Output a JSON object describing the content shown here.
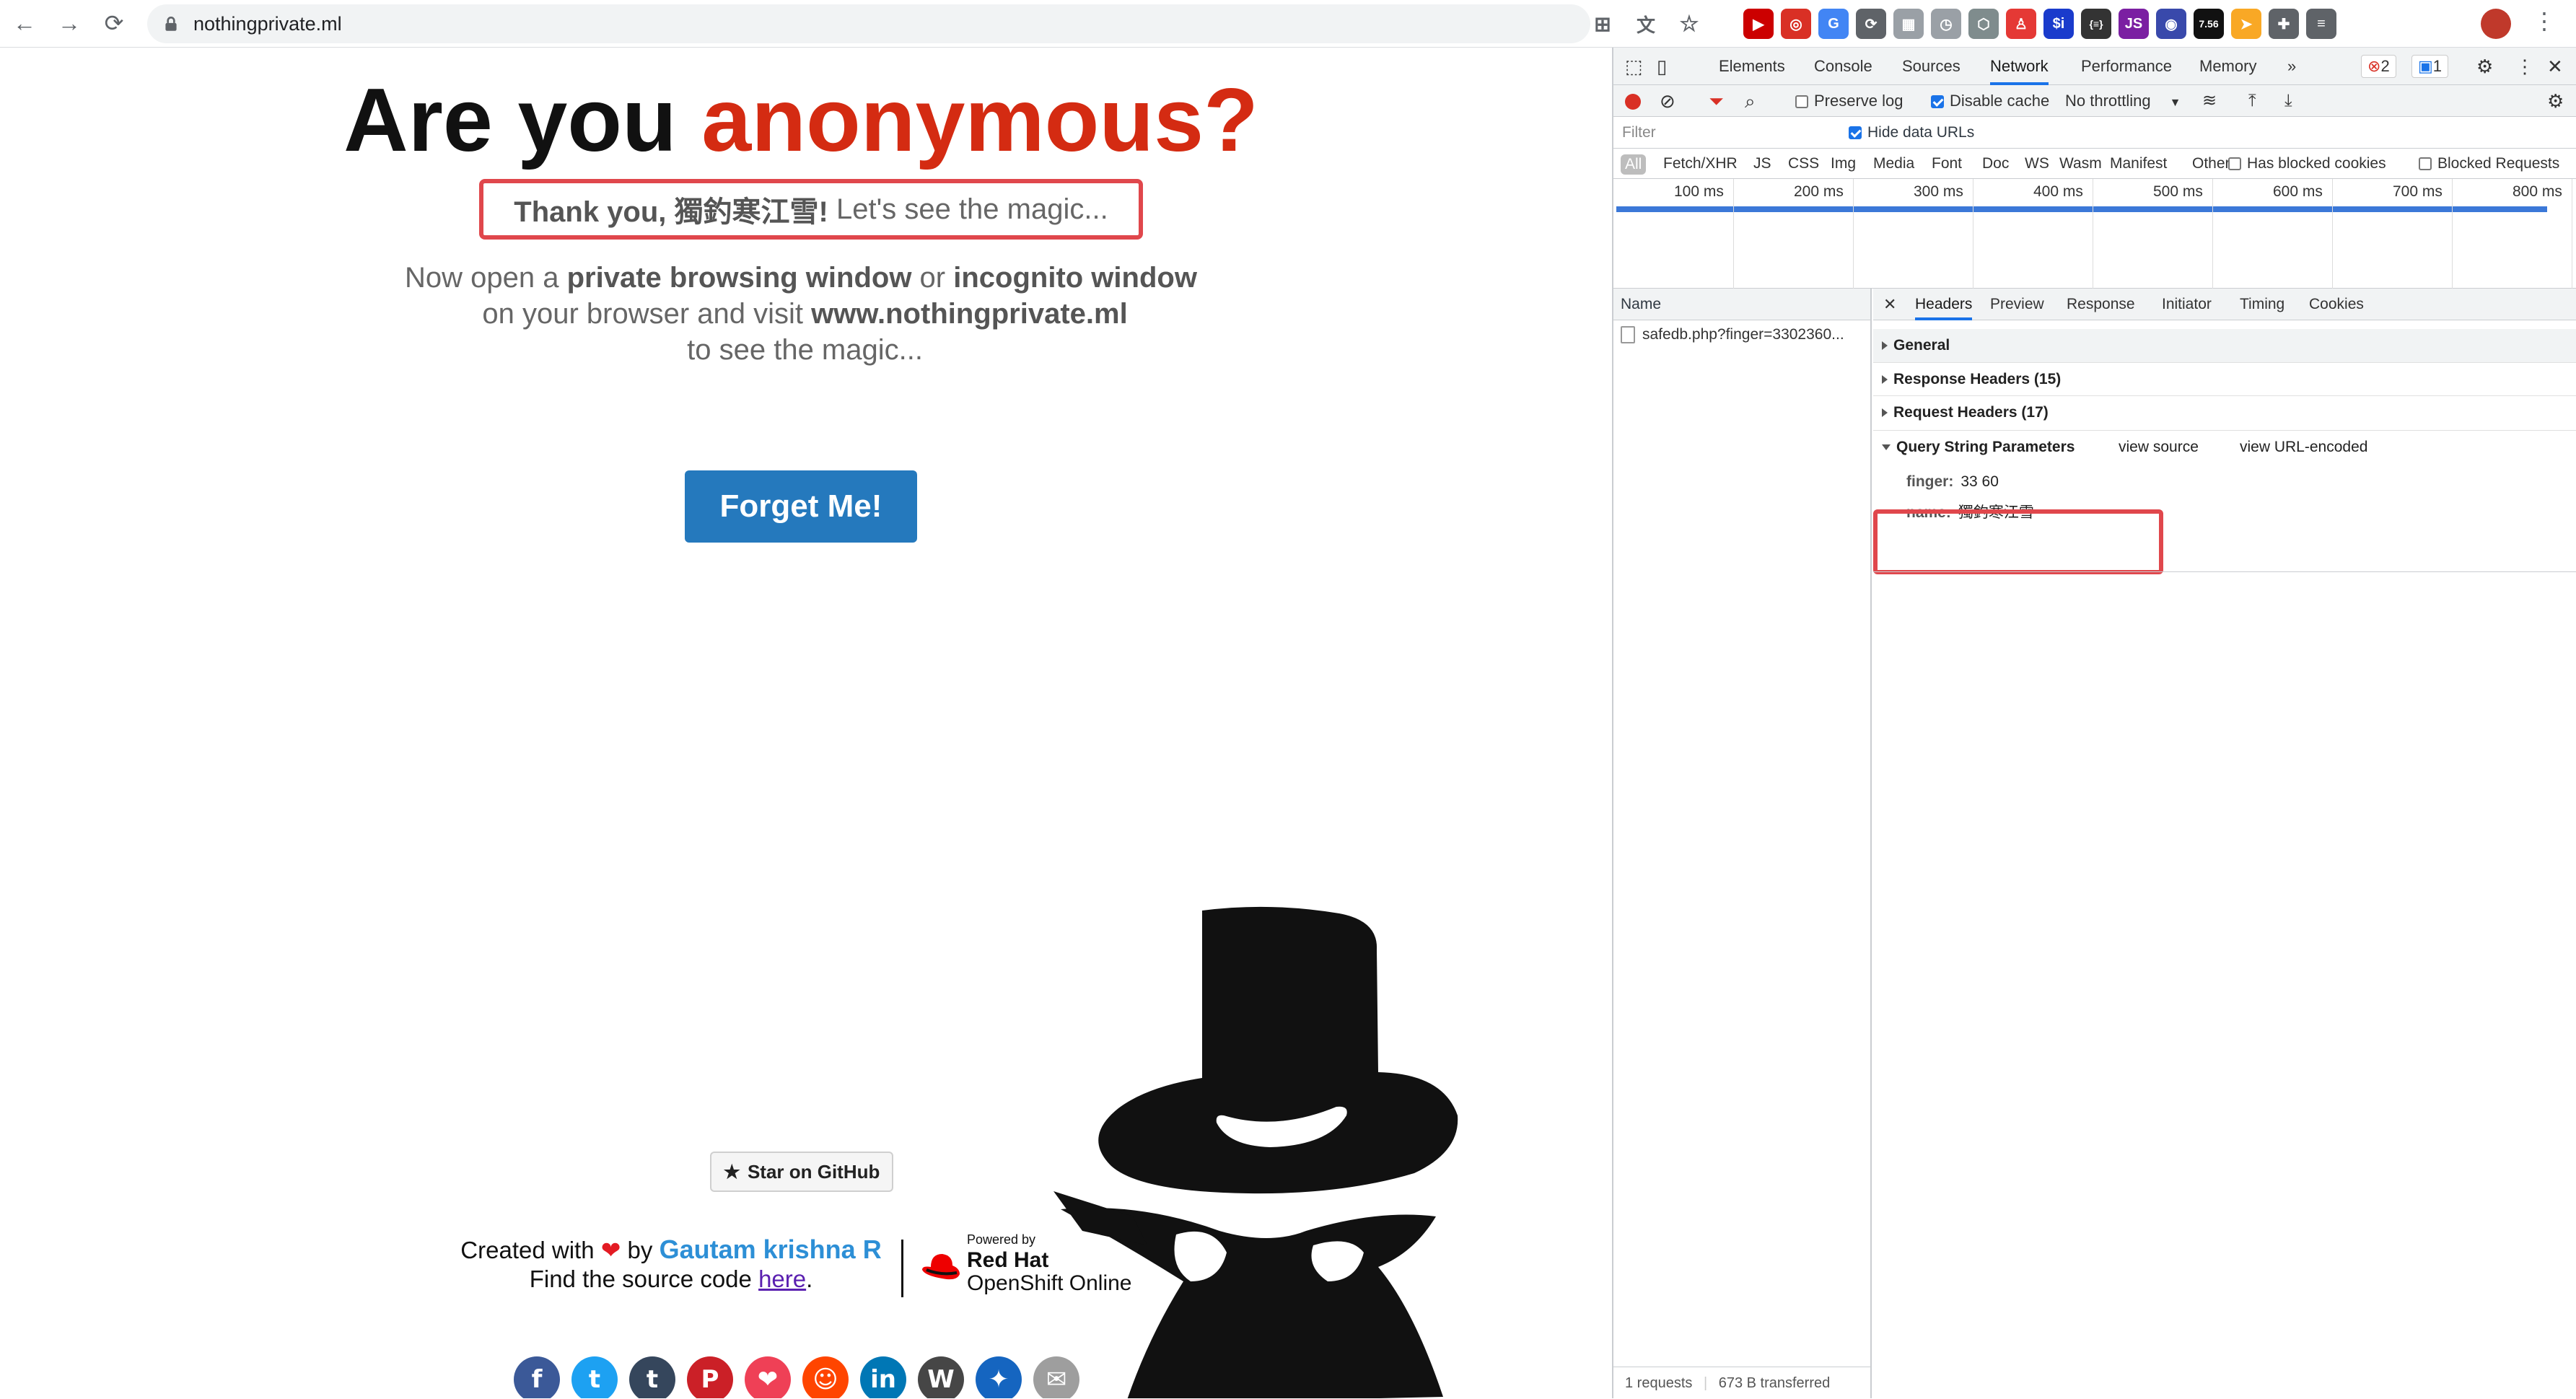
{
  "browser": {
    "url": "nothingprivate.ml",
    "extensions": [
      {
        "name": "youtube-ext-icon",
        "color": "#c00",
        "glyph": "▶"
      },
      {
        "name": "target-ext-icon",
        "color": "#d93025",
        "glyph": "◎"
      },
      {
        "name": "translate-ext-icon",
        "color": "#4285f4",
        "glyph": "G"
      },
      {
        "name": "refresh-ext-icon",
        "color": "#5f6368",
        "glyph": "⟳"
      },
      {
        "name": "grid-ext-icon",
        "color": "#9aa0a6",
        "glyph": "▦"
      },
      {
        "name": "clock-ext-icon",
        "color": "#9aa0a6",
        "glyph": "◷"
      },
      {
        "name": "shield-ext-icon",
        "color": "#7f8c8d",
        "glyph": "⬡"
      },
      {
        "name": "person-ext-icon",
        "color": "#e53935",
        "glyph": "♙"
      },
      {
        "name": "si-ext-icon",
        "color": "#1a3bcc",
        "glyph": "$i"
      },
      {
        "name": "json-ext-icon",
        "color": "#333",
        "glyph": "{≡}"
      },
      {
        "name": "jsp-ext-icon",
        "color": "#7b1fa2",
        "glyph": "JS"
      },
      {
        "name": "eye-ext-icon",
        "color": "#3949ab",
        "glyph": "◉"
      },
      {
        "name": "lcp-ext-icon",
        "color": "#111",
        "glyph": "7.56"
      },
      {
        "name": "arrow-ext-icon",
        "color": "#f9a825",
        "glyph": "➤"
      },
      {
        "name": "puzzle-ext-icon",
        "color": "#5f6368",
        "glyph": "✚"
      },
      {
        "name": "list-ext-icon",
        "color": "#5f6368",
        "glyph": "≡"
      }
    ]
  },
  "page": {
    "headline_plain": "Are you ",
    "headline_accent": "anonymous?",
    "thanks_bold": "Thank you, 獨釣寒江雪!",
    "thanks_rest": " Let's see the magic...",
    "instr_1": "Now open a ",
    "instr_b1": "private browsing window",
    "instr_2": " or ",
    "instr_b2": "incognito window",
    "instr_3": " on your browser and visit ",
    "instr_b3": "www.nothingprivate.ml",
    "instr_4": " to see the magic...",
    "forget_label": "Forget Me!",
    "github_label": "Star on GitHub",
    "credit_1": "Created with ",
    "credit_2": " by ",
    "author": "Gautam krishna R",
    "credit_3": "Find the source code ",
    "here": "here",
    "credit_4": ".",
    "powered_by": "Powered by",
    "redhat": "Red Hat",
    "openshift": "OpenShift Online",
    "social": [
      {
        "name": "facebook-icon",
        "color": "#3b5998",
        "glyph": "f"
      },
      {
        "name": "twitter-icon",
        "color": "#1da1f2",
        "glyph": "t"
      },
      {
        "name": "tumblr-icon",
        "color": "#35465c",
        "glyph": "t"
      },
      {
        "name": "pinterest-icon",
        "color": "#cb2027",
        "glyph": "P"
      },
      {
        "name": "pocket-icon",
        "color": "#ef4056",
        "glyph": "❤"
      },
      {
        "name": "reddit-icon",
        "color": "#ff4500",
        "glyph": "☺"
      },
      {
        "name": "linkedin-icon",
        "color": "#0077b5",
        "glyph": "in"
      },
      {
        "name": "wordpress-icon",
        "color": "#464646",
        "glyph": "W"
      },
      {
        "name": "pin-icon",
        "color": "#1565c0",
        "glyph": "✦"
      },
      {
        "name": "email-icon",
        "color": "#9e9e9e",
        "glyph": "✉"
      }
    ]
  },
  "devtools": {
    "tabs": [
      "Elements",
      "Console",
      "Sources",
      "Network",
      "Performance",
      "Memory"
    ],
    "active_tab": "Network",
    "more": "»",
    "error_count": "2",
    "message_count": "1",
    "preserve_log": "Preserve log",
    "disable_cache": "Disable cache",
    "throttling": "No throttling",
    "filter_placeholder": "Filter",
    "hide_data_urls": "Hide data URLs",
    "types": [
      "All",
      "Fetch/XHR",
      "JS",
      "CSS",
      "Img",
      "Media",
      "Font",
      "Doc",
      "WS",
      "Wasm",
      "Manifest",
      "Other"
    ],
    "has_blocked_cookies": "Has blocked cookies",
    "blocked_requests": "Blocked Requests",
    "timeline_labels": [
      "100 ms",
      "200 ms",
      "300 ms",
      "400 ms",
      "500 ms",
      "600 ms",
      "700 ms",
      "800 ms"
    ],
    "name_header": "Name",
    "request_name": "safedb.php?finger=3302360...",
    "detail_tabs": [
      "Headers",
      "Preview",
      "Response",
      "Initiator",
      "Timing",
      "Cookies"
    ],
    "active_detail_tab": "Headers",
    "sections": {
      "general": "General",
      "response_headers": "Response Headers (15)",
      "request_headers": "Request Headers (17)",
      "query_params": "Query String Parameters",
      "view_source": "view source",
      "view_url_encoded": "view URL-encoded"
    },
    "params": [
      {
        "key": "finger:",
        "value": "33 60"
      },
      {
        "key": "name:",
        "value": "獨釣寒江雪"
      }
    ],
    "requests_count": "1 requests",
    "transferred": "673 B transferred"
  }
}
